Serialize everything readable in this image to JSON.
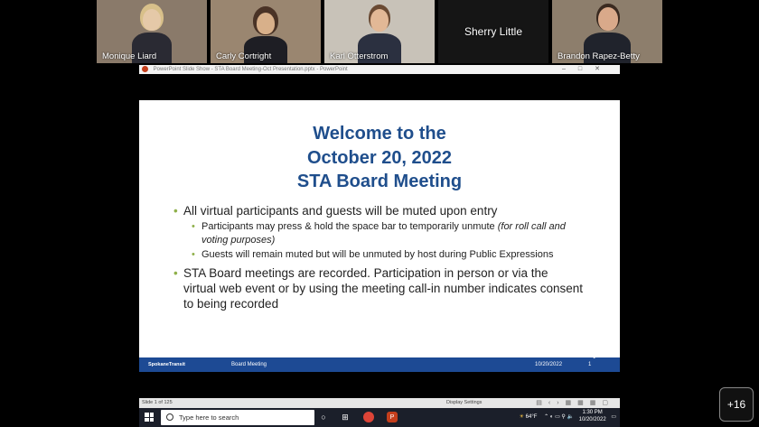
{
  "participants": [
    {
      "name": "Monique Liard"
    },
    {
      "name": "Carly Cortright"
    },
    {
      "name": "Karl Otterstrom"
    },
    {
      "name": "Sherry Little"
    },
    {
      "name": "Brandon Rapez-Betty"
    }
  ],
  "more_participants": "+16",
  "ppt_window": {
    "title": "PowerPoint Slide Show - STA Board Meeting-Oct Presentation.pptx - PowerPoint"
  },
  "slide": {
    "title_line1": "Welcome to the",
    "title_line2": "October 20, 2022",
    "title_line3": "STA Board Meeting",
    "bullet1": "All virtual participants and guests will be muted upon entry",
    "sub1_text": "Participants may press & hold the space bar to temporarily unmute ",
    "sub1_italic": "(for roll call and voting purposes)",
    "sub2": "Guests will remain muted but will be unmuted by host during Public Expressions",
    "bullet2": "STA Board meetings are recorded. Participation in person or via the virtual web event or by using the meeting call-in number indicates consent to being recorded",
    "footer_logo": "SpokaneTransit",
    "footer_label": "Board Meeting",
    "footer_date": "10/20/2022",
    "footer_page": "1"
  },
  "statusbar": {
    "slide_count": "Slide 1 of 125",
    "display_settings": "Display Settings"
  },
  "taskbar": {
    "search_placeholder": "Type here to search",
    "weather": "64°F",
    "time": "1:30 PM",
    "date": "10/20/2022"
  },
  "colors": {
    "title_blue": "#1f4e8c",
    "footer_blue": "#1d4a94",
    "bullet_green": "#8fb04a"
  }
}
